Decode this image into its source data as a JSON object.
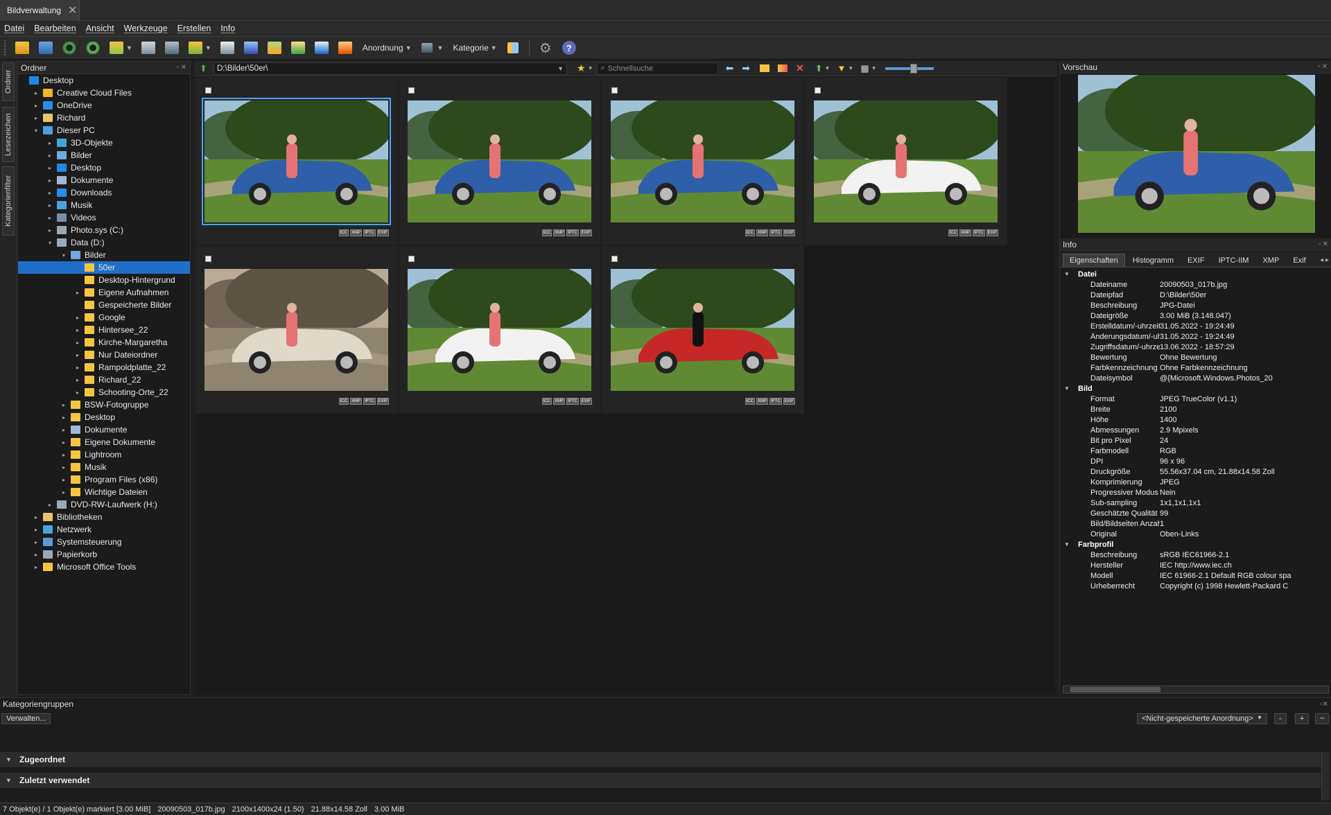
{
  "window": {
    "tab_title": "Bildverwaltung"
  },
  "menu": [
    "Datei",
    "Bearbeiten",
    "Ansicht",
    "Werkzeuge",
    "Erstellen",
    "Info"
  ],
  "toolbar": {
    "arrange_label": "Anordnung",
    "category_label": "Kategorie"
  },
  "left_tabs": [
    "Ordner",
    "Lesezeichen",
    "Kategorienfilter"
  ],
  "folder_panel": {
    "title": "Ordner"
  },
  "tree": [
    {
      "label": "Desktop",
      "level": 0,
      "expand": "",
      "icon": "desktop-icon",
      "color": "#1e88e5"
    },
    {
      "label": "Creative Cloud Files",
      "level": 1,
      "expand": "▸",
      "icon": "folder-icon",
      "color": "#f0b429"
    },
    {
      "label": "OneDrive",
      "level": 1,
      "expand": "▸",
      "icon": "cloud-icon",
      "color": "#2b8de8"
    },
    {
      "label": "Richard",
      "level": 1,
      "expand": "▸",
      "icon": "user-icon",
      "color": "#e9c46a"
    },
    {
      "label": "Dieser PC",
      "level": 1,
      "expand": "▾",
      "icon": "computer-icon",
      "color": "#4aa3df"
    },
    {
      "label": "3D-Objekte",
      "level": 2,
      "expand": "▸",
      "icon": "cube-icon",
      "color": "#3fa7d6"
    },
    {
      "label": "Bilder",
      "level": 2,
      "expand": "▸",
      "icon": "pictures-icon",
      "color": "#6fa8dc"
    },
    {
      "label": "Desktop",
      "level": 2,
      "expand": "▸",
      "icon": "desktop-icon",
      "color": "#1e88e5"
    },
    {
      "label": "Dokumente",
      "level": 2,
      "expand": "▸",
      "icon": "document-icon",
      "color": "#9fb8d6"
    },
    {
      "label": "Downloads",
      "level": 2,
      "expand": "▸",
      "icon": "download-icon",
      "color": "#2b8de8"
    },
    {
      "label": "Musik",
      "level": 2,
      "expand": "▸",
      "icon": "music-icon",
      "color": "#4aa3df"
    },
    {
      "label": "Videos",
      "level": 2,
      "expand": "▸",
      "icon": "video-icon",
      "color": "#7a8fa6"
    },
    {
      "label": "Photo.sys (C:)",
      "level": 2,
      "expand": "▸",
      "icon": "drive-icon",
      "color": "#9aa9b8"
    },
    {
      "label": "Data (D:)",
      "level": 2,
      "expand": "▾",
      "icon": "drive-icon",
      "color": "#9aa9b8"
    },
    {
      "label": "Bilder",
      "level": 3,
      "expand": "▾",
      "icon": "pictures-icon",
      "color": "#6fa8dc"
    },
    {
      "label": "50er",
      "level": 4,
      "expand": "",
      "icon": "folder-icon",
      "color": "#f5c542",
      "selected": true
    },
    {
      "label": "Desktop-Hintergrund",
      "level": 4,
      "expand": "",
      "icon": "folder-icon",
      "color": "#f5c542"
    },
    {
      "label": "Eigene Aufnahmen",
      "level": 4,
      "expand": "▸",
      "icon": "folder-icon",
      "color": "#f5c542"
    },
    {
      "label": "Gespeicherte Bilder",
      "level": 4,
      "expand": "",
      "icon": "folder-icon",
      "color": "#f5c542"
    },
    {
      "label": "Google",
      "level": 4,
      "expand": "▸",
      "icon": "folder-icon",
      "color": "#f5c542"
    },
    {
      "label": "Hintersee_22",
      "level": 4,
      "expand": "▸",
      "icon": "folder-icon",
      "color": "#f5c542"
    },
    {
      "label": "Kirche-Margaretha",
      "level": 4,
      "expand": "▸",
      "icon": "folder-icon",
      "color": "#f5c542"
    },
    {
      "label": "Nur Dateiordner",
      "level": 4,
      "expand": "▸",
      "icon": "folder-icon",
      "color": "#f5c542"
    },
    {
      "label": "Rampoldplatte_22",
      "level": 4,
      "expand": "▸",
      "icon": "folder-icon",
      "color": "#f5c542"
    },
    {
      "label": "Richard_22",
      "level": 4,
      "expand": "▸",
      "icon": "folder-icon",
      "color": "#f5c542"
    },
    {
      "label": "Schooting-Orte_22",
      "level": 4,
      "expand": "▸",
      "icon": "folder-icon",
      "color": "#f5c542"
    },
    {
      "label": "BSW-Fotogruppe",
      "level": 3,
      "expand": "▸",
      "icon": "folder-icon",
      "color": "#f5c542"
    },
    {
      "label": "Desktop",
      "level": 3,
      "expand": "▸",
      "icon": "folder-icon",
      "color": "#f5c542"
    },
    {
      "label": "Dokumente",
      "level": 3,
      "expand": "▸",
      "icon": "document-icon",
      "color": "#9fb8d6"
    },
    {
      "label": "Eigene Dokumente",
      "level": 3,
      "expand": "▸",
      "icon": "folder-icon",
      "color": "#f5c542"
    },
    {
      "label": "Lightroom",
      "level": 3,
      "expand": "▸",
      "icon": "folder-icon",
      "color": "#f5c542"
    },
    {
      "label": "Musik",
      "level": 3,
      "expand": "▸",
      "icon": "folder-icon",
      "color": "#f5c542"
    },
    {
      "label": "Program Files (x86)",
      "level": 3,
      "expand": "▸",
      "icon": "folder-icon",
      "color": "#f5c542"
    },
    {
      "label": "Wichtige Dateien",
      "level": 3,
      "expand": "▸",
      "icon": "folder-icon",
      "color": "#f5c542"
    },
    {
      "label": "DVD-RW-Laufwerk (H:)",
      "level": 2,
      "expand": "▸",
      "icon": "dvd-icon",
      "color": "#9aa9b8"
    },
    {
      "label": "Bibliotheken",
      "level": 1,
      "expand": "▸",
      "icon": "library-icon",
      "color": "#e9c46a"
    },
    {
      "label": "Netzwerk",
      "level": 1,
      "expand": "▸",
      "icon": "network-icon",
      "color": "#4aa3df"
    },
    {
      "label": "Systemsteuerung",
      "level": 1,
      "expand": "▸",
      "icon": "control-panel-icon",
      "color": "#5b9bd5"
    },
    {
      "label": "Papierkorb",
      "level": 1,
      "expand": "▸",
      "icon": "trash-icon",
      "color": "#9aa9b8"
    },
    {
      "label": "Microsoft Office Tools",
      "level": 1,
      "expand": "▸",
      "icon": "folder-icon",
      "color": "#f5c542"
    }
  ],
  "pathbar": {
    "path": "D:\\Bilder\\50er\\",
    "search_placeholder": "Schnellsuche"
  },
  "thumbnails": [
    {
      "scene": "blue-car-couple",
      "selected": true
    },
    {
      "scene": "blue-car-group",
      "selected": false
    },
    {
      "scene": "blue-car-dance",
      "selected": false
    },
    {
      "scene": "white-car-lady",
      "selected": false
    },
    {
      "scene": "sepia-white-car",
      "selected": false
    },
    {
      "scene": "white-car-two",
      "selected": false
    },
    {
      "scene": "red-car-lady",
      "selected": false
    }
  ],
  "badges": [
    "ICC",
    "XMP",
    "IPTC",
    "EXIF"
  ],
  "preview": {
    "title": "Vorschau"
  },
  "info": {
    "title": "Info",
    "tabs": [
      "Eigenschaften",
      "Histogramm",
      "EXIF",
      "IPTC-IIM",
      "XMP",
      "Exif"
    ],
    "groups": [
      {
        "name": "Datei",
        "rows": [
          [
            "Dateiname",
            "20090503_017b.jpg"
          ],
          [
            "Dateipfad",
            "D:\\Bilder\\50er"
          ],
          [
            "Beschreibung",
            "JPG-Datei"
          ],
          [
            "Dateigröße",
            "3.00 MiB (3.148.047)"
          ],
          [
            "Erstelldatum/-uhrzeit",
            "31.05.2022 - 19:24:49"
          ],
          [
            "Änderungsdatum/-uhrzeit",
            "31.05.2022 - 19:24:49"
          ],
          [
            "Zugriffsdatum/-uhrzeit",
            "13.06.2022 - 18:57:29"
          ],
          [
            "Bewertung",
            "Ohne Bewertung"
          ],
          [
            "Farbkennzeichnung",
            "Ohne Farbkennzeichnung"
          ],
          [
            "Dateisymbol",
            "@{Microsoft.Windows.Photos_20"
          ]
        ]
      },
      {
        "name": "Bild",
        "rows": [
          [
            "Format",
            "JPEG TrueColor (v1.1)"
          ],
          [
            "Breite",
            "2100"
          ],
          [
            "Höhe",
            "1400"
          ],
          [
            "Abmessungen",
            "2.9 Mpixels"
          ],
          [
            "Bit pro Pixel",
            "24"
          ],
          [
            "Farbmodell",
            "RGB"
          ],
          [
            "DPI",
            "96 x 96"
          ],
          [
            "Druckgröße",
            "55.56x37.04 cm, 21.88x14.58 Zoll"
          ],
          [
            "Komprimierung",
            "JPEG"
          ],
          [
            "Progressiver Modus",
            "Nein"
          ],
          [
            "Sub-sampling",
            "1x1,1x1,1x1"
          ],
          [
            "Geschätzte Qualität",
            "99"
          ],
          [
            "Bild/Bildseiten Anzahl",
            "1"
          ],
          [
            "Original",
            "Oben-Links"
          ]
        ]
      },
      {
        "name": "Farbprofil",
        "rows": [
          [
            "Beschreibung",
            "sRGB IEC61966-2.1"
          ],
          [
            "Hersteller",
            "IEC http://www.iec.ch"
          ],
          [
            "Modell",
            "IEC 61966-2.1 Default RGB colour spa"
          ],
          [
            "Urheberrecht",
            "Copyright (c) 1998 Hewlett-Packard C"
          ]
        ]
      }
    ]
  },
  "bottom": {
    "title": "Kategoriengruppen",
    "manage_label": "Verwalten...",
    "arrangement": "<Nicht-gespeicherte Anordnung>",
    "sections": [
      "Zugeordnet",
      "Zuletzt verwendet"
    ]
  },
  "status": [
    "7 Objekt(e) / 1 Objekt(e) markiert [3.00 MiB]",
    "20090503_017b.jpg",
    "2100x1400x24 (1.50)",
    "21.88x14.58 Zoll",
    "3.00 MiB"
  ]
}
